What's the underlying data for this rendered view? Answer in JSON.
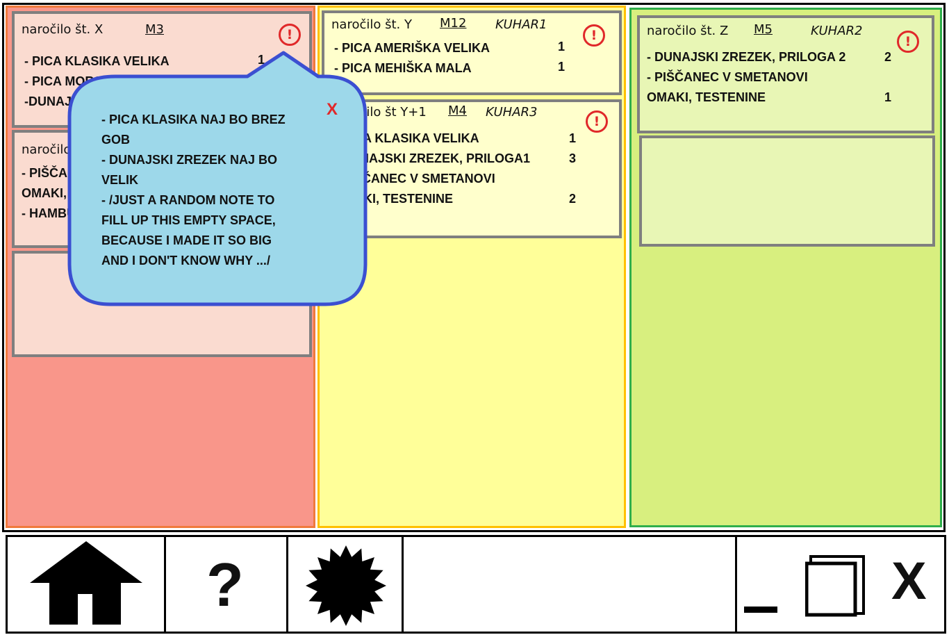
{
  "orders": {
    "x": {
      "title": "naročilo št. X",
      "table": "M3",
      "items": [
        {
          "name": "- PICA KLASIKA VELIKA",
          "qty": "1"
        },
        {
          "name": "- PICA MORSKA",
          "qty": ""
        },
        {
          "name": "-DUNAJSKI ZREZEK",
          "qty": ""
        }
      ]
    },
    "x2": {
      "title": "naročilo št. X+1",
      "items": [
        {
          "name": "- PIŠČANEC V SMETANOVI"
        },
        {
          "name": "OMAKI, TESTENINE"
        },
        {
          "name": "- HAMBURGER"
        }
      ]
    },
    "y": {
      "title": "naročilo št. Y",
      "table": "M12",
      "cook": "KUHAR1",
      "items": [
        {
          "name": "- PICA AMERIŠKA VELIKA",
          "qty": "1"
        },
        {
          "name": "- PICA MEHIŠKA MALA",
          "qty": "1"
        }
      ]
    },
    "y1": {
      "title": "naročilo št Y+1",
      "table": "M4",
      "cook": "KUHAR3",
      "items": [
        {
          "name": "- PICA KLASIKA VELIKA",
          "qty": "1"
        },
        {
          "name": "- DUNAJSKI ZREZEK, PRILOGA1",
          "qty": "3"
        },
        {
          "name": "- PIŠČANEC V SMETANOVI",
          "qty": ""
        },
        {
          "name": "OMAKI, TESTENINE",
          "qty": "2"
        }
      ]
    },
    "z": {
      "title": "naročilo št. Z",
      "table": "M5",
      "cook": "KUHAR2",
      "items": [
        {
          "name": "- DUNAJSKI ZREZEK, PRILOGA 2",
          "qty": "2"
        },
        {
          "name": "- PIŠČANEC V SMETANOVI",
          "qty": ""
        },
        {
          "name": "OMAKI, TESTENINE",
          "qty": "1"
        }
      ]
    }
  },
  "alert_symbol": "!",
  "note": {
    "lines": [
      "- PICA KLASIKA NAJ BO BREZ",
      "GOB",
      "- DUNAJSKI ZREZEK NAJ BO",
      "VELIK",
      "- /JUST A RANDOM NOTE TO",
      "FILL UP THIS EMPTY SPACE,",
      "BECAUSE I MADE IT SO BIG",
      "AND I DON'T KNOW WHY .../"
    ],
    "close": "X"
  },
  "toolbar": {
    "home_icon": "home-icon",
    "help_label": "?",
    "settings_icon": "gear-icon",
    "minimize_label": "_",
    "maximize_icon": "window-icon",
    "close_label": "X"
  },
  "colors": {
    "column_red": "#f9968a",
    "column_yellow": "#ffff99",
    "column_green": "#d8ef7f",
    "alert_red": "#e0282a",
    "note_bubble": "#9dd8ea",
    "note_border": "#3b4fd1"
  }
}
